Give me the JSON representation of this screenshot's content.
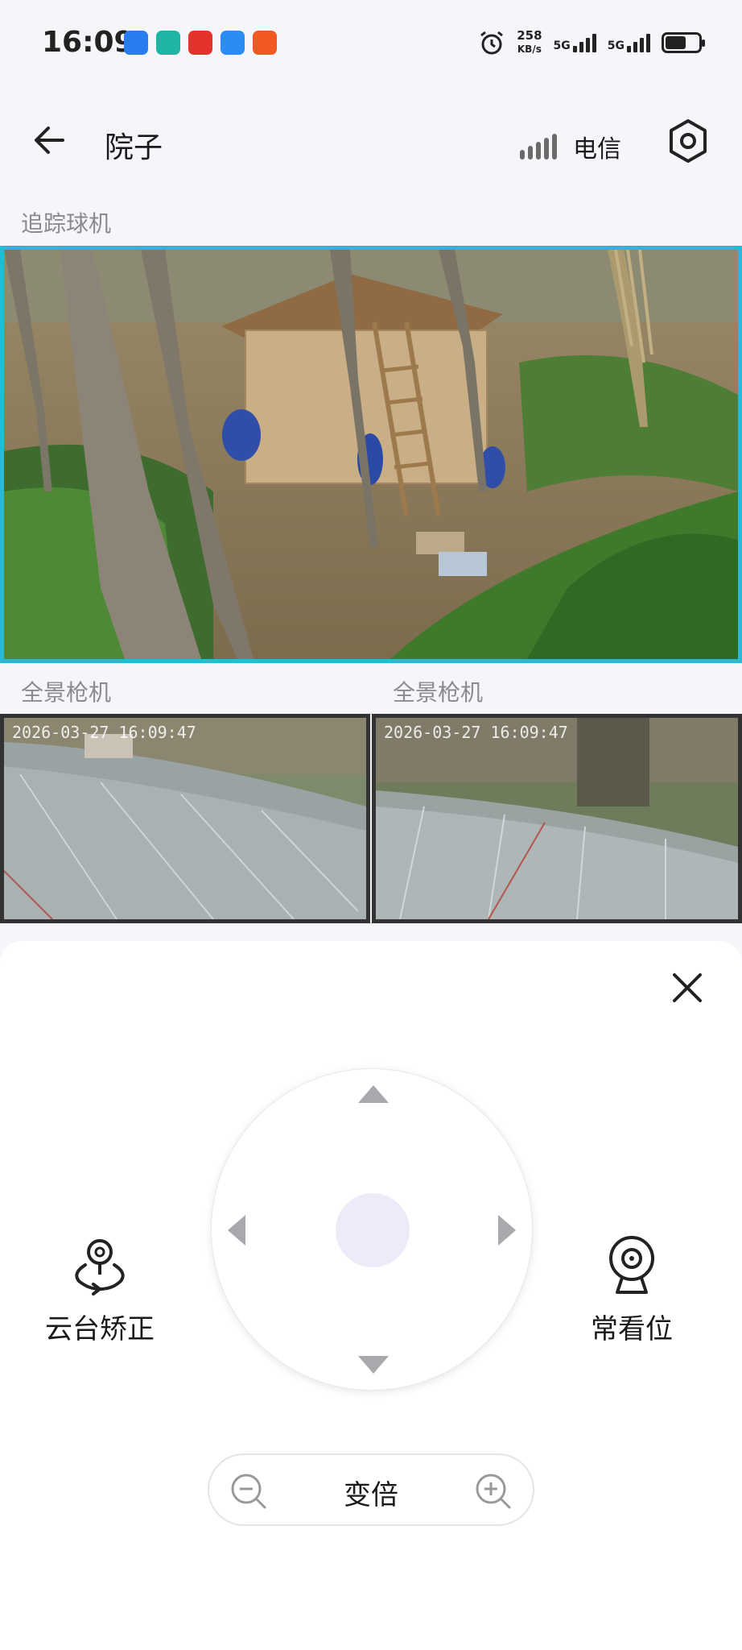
{
  "status_bar": {
    "time": "16:09",
    "speed_value": "258",
    "speed_unit": "KB/s",
    "network_1": "5G",
    "network_2": "5G",
    "app_icon_colors": [
      "#2a7df0",
      "#1fb5a5",
      "#e5322d",
      "#2b8cf3",
      "#f05a22"
    ]
  },
  "header": {
    "title": "院子",
    "carrier": "电信"
  },
  "cameras": {
    "main": {
      "label": "追踪球机"
    },
    "left": {
      "label": "全景枪机",
      "timestamp": "2026-03-27 16:09:47"
    },
    "right": {
      "label": "全景枪机",
      "timestamp": "2026-03-27 16:09:47"
    }
  },
  "controls": {
    "ptz_calibrate_label": "云台矫正",
    "favorite_position_label": "常看位",
    "zoom_label": "变倍"
  },
  "colors": {
    "accent": "#2bb7d6",
    "ptz_center": "#ebecf7"
  }
}
